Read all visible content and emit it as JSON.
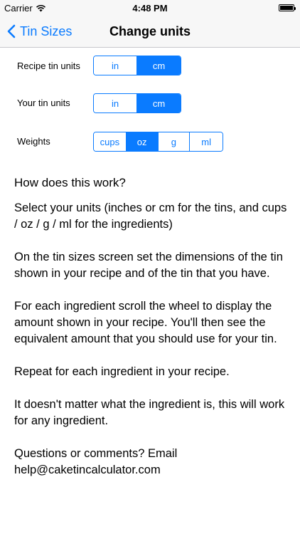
{
  "status_bar": {
    "carrier": "Carrier",
    "time": "4:48 PM",
    "wifi_icon": "wifi-icon",
    "battery_icon": "battery-icon"
  },
  "nav": {
    "back_label": "Tin Sizes",
    "back_icon": "chevron-left-icon",
    "title": "Change units",
    "accent_color": "#0a7bff"
  },
  "settings": {
    "recipe_tin": {
      "label": "Recipe tin units",
      "options": [
        "in",
        "cm"
      ],
      "selected": "cm"
    },
    "your_tin": {
      "label": "Your tin units",
      "options": [
        "in",
        "cm"
      ],
      "selected": "cm"
    },
    "weights": {
      "label": "Weights",
      "options": [
        "cups",
        "oz",
        "g",
        "ml"
      ],
      "selected": "oz"
    }
  },
  "help": {
    "heading": "How does this work?",
    "paragraphs": [
      "Select your units (inches or cm for the tins, and cups / oz / g / ml for the ingredients)",
      "On the tin sizes screen set the dimensions of the tin shown in your recipe and of the tin that you have.",
      "For each ingredient scroll the wheel to display the amount shown in your recipe. You'll then see the equivalent amount that you should use for your tin.",
      "Repeat for each ingredient in  your recipe.",
      "It doesn't matter what the ingredient is, this will work for any ingredient."
    ],
    "contact_prompt": "Questions or comments? Email",
    "contact_email": "help@caketincalculator.com"
  }
}
